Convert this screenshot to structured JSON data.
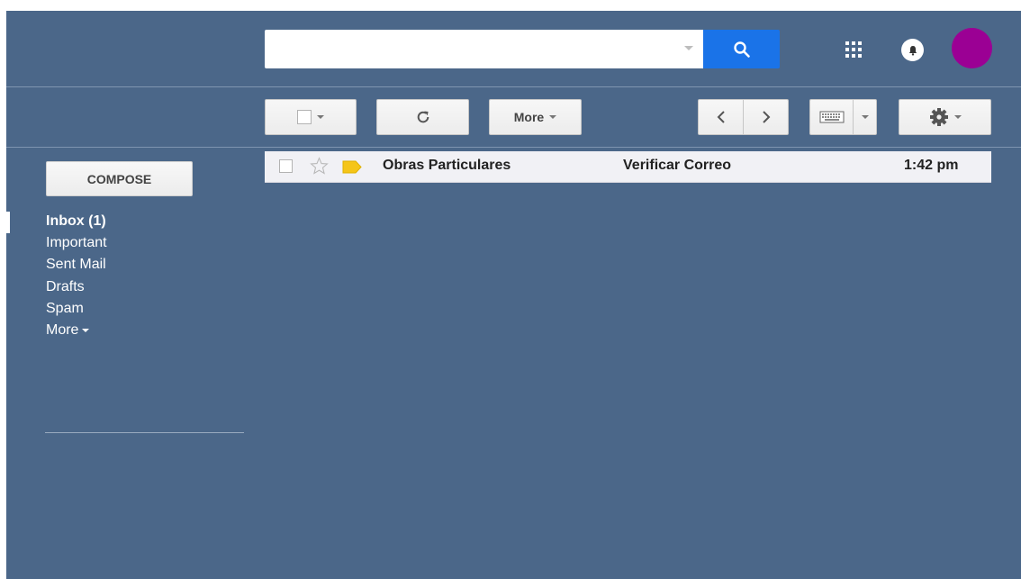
{
  "search": {
    "placeholder": "",
    "value": "",
    "button_icon": "search-icon"
  },
  "header": {
    "apps_icon": "apps-grid-icon",
    "notifications_icon": "bell-icon",
    "avatar_color": "#9b0094"
  },
  "toolbar": {
    "select_icon": "checkbox-icon",
    "refresh_icon": "refresh-icon",
    "more_label": "More",
    "prev_icon": "chevron-left-icon",
    "next_icon": "chevron-right-icon",
    "keyboard_icon": "keyboard-icon",
    "settings_icon": "gear-icon"
  },
  "sidebar": {
    "compose_label": "COMPOSE",
    "items": [
      {
        "label": "Inbox (1)"
      },
      {
        "label": "Important"
      },
      {
        "label": "Sent Mail"
      },
      {
        "label": "Drafts"
      },
      {
        "label": "Spam"
      },
      {
        "label": "More"
      }
    ]
  },
  "emails": [
    {
      "sender": "Obras Particulares",
      "subject": "Verificar Correo",
      "time": "1:42 pm",
      "unread": true,
      "starred": false
    }
  ],
  "colors": {
    "background": "#4b6789",
    "search_button": "#1a73e8",
    "label_tag": "#f5c518"
  }
}
